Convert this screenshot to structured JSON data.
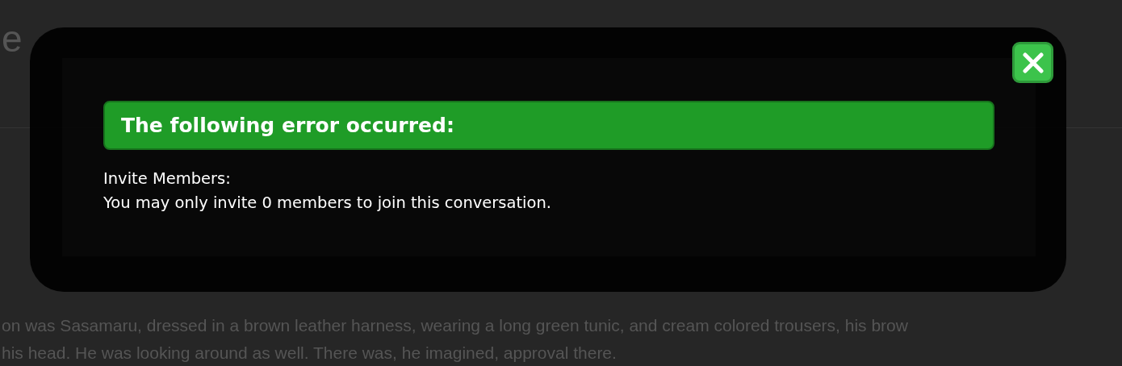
{
  "page": {
    "title": "e",
    "lines": [
      "on was Sasamaru, dressed in a brown leather harness, wearing a long green tunic, and cream colored trousers, his brow",
      "his head. He was looking around as well. There was, he imagined, approval there."
    ]
  },
  "dialog": {
    "heading": "The following error occurred:",
    "lines": [
      "Invite Members:",
      "You may only invite 0 members to join this conversation."
    ]
  }
}
